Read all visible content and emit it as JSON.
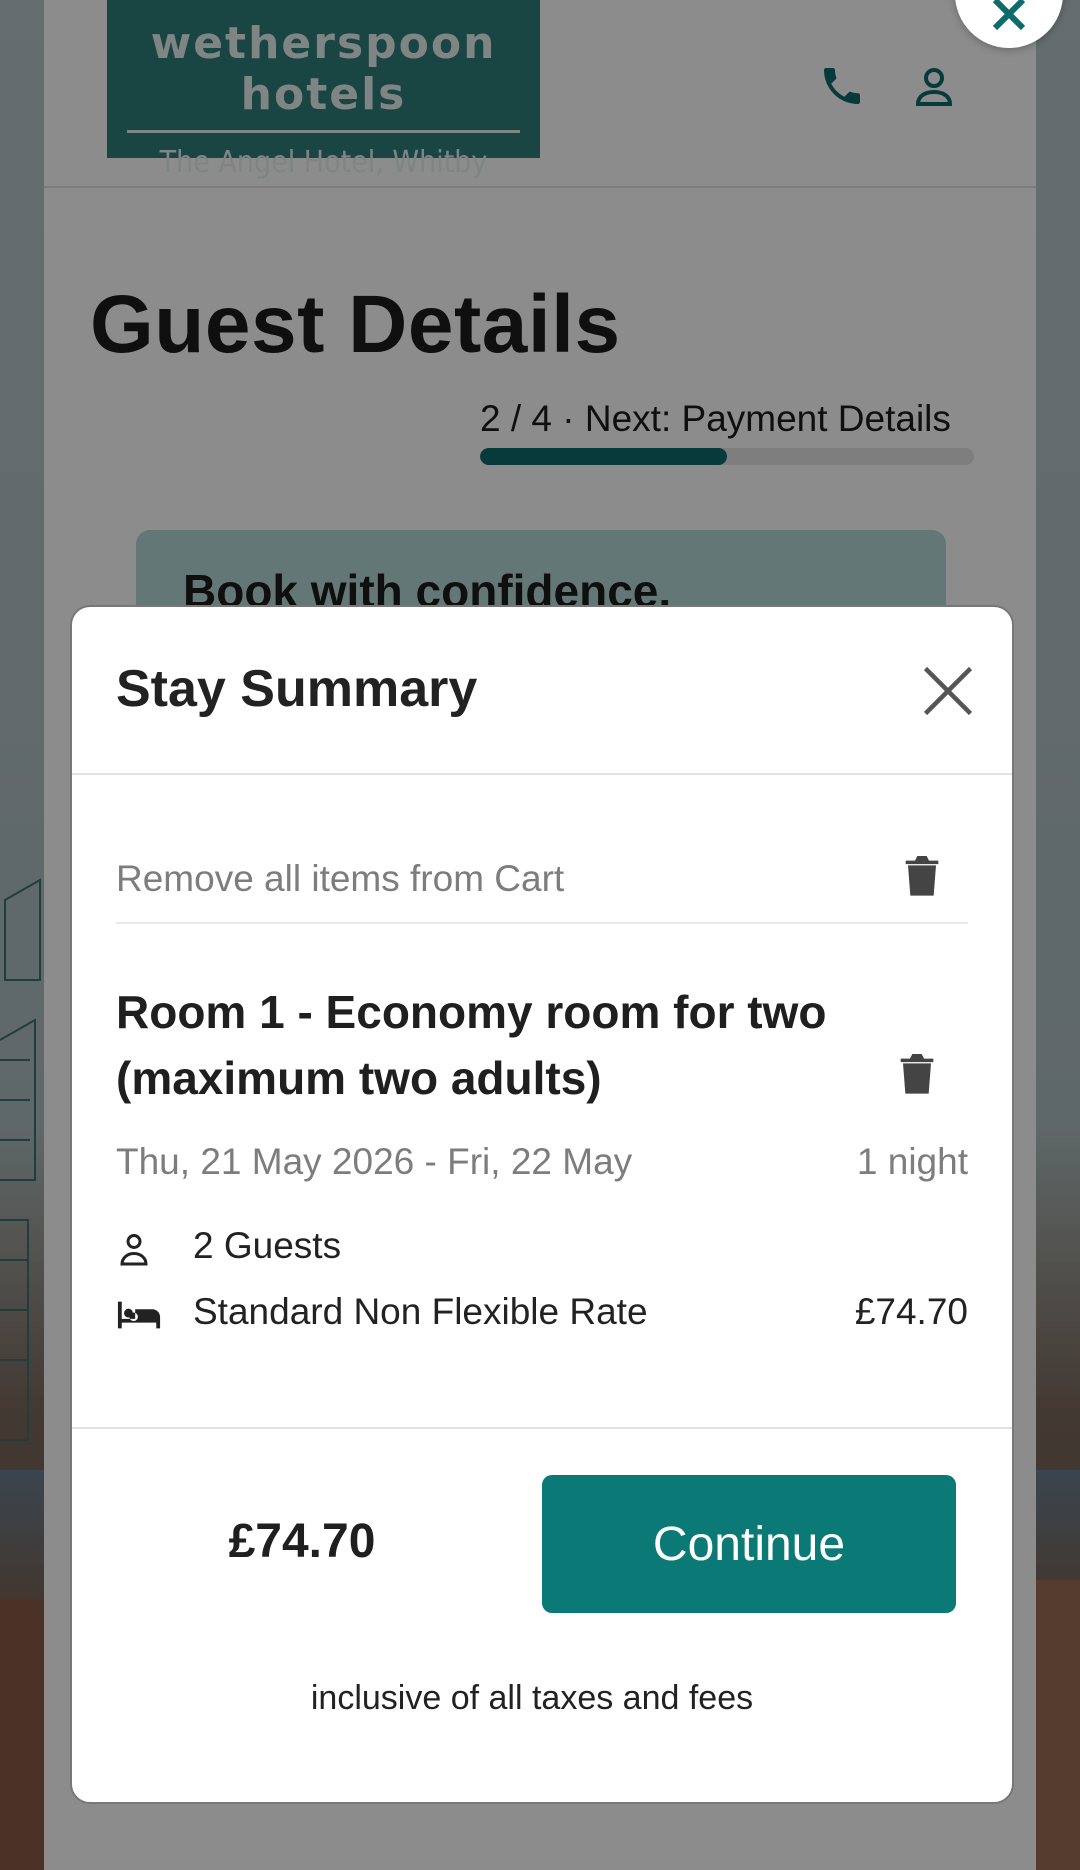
{
  "header": {
    "logo_brand": "wetherspoon hotels",
    "logo_subtitle": "The Angel Hotel, Whitby",
    "phone_icon": "phone-icon",
    "account_icon": "user-icon"
  },
  "page": {
    "title": "Guest Details",
    "progress": {
      "text": "2 / 4 · Next: Payment Details",
      "step": 2,
      "total_steps": 4,
      "fraction": 0.5
    },
    "promo_text": "Book with confidence."
  },
  "modal": {
    "title": "Stay Summary",
    "remove_all_label": "Remove all items from Cart",
    "room": {
      "name": "Room 1 - Economy room for two (maximum two adults)",
      "dates": "Thu, 21 May 2026 - Fri, 22 May",
      "nights": "1 night",
      "guests": "2 Guests",
      "rate_name": "Standard Non Flexible Rate",
      "rate_price": "£74.70"
    },
    "total": "£74.70",
    "continue_label": "Continue",
    "tax_note": "inclusive of all taxes and fees"
  },
  "colors": {
    "brand_teal": "#0b7a77",
    "progress_fill": "#0e6b6b",
    "logo_bg": "#2f7e7a",
    "promo_bg": "#b4dbd7"
  }
}
